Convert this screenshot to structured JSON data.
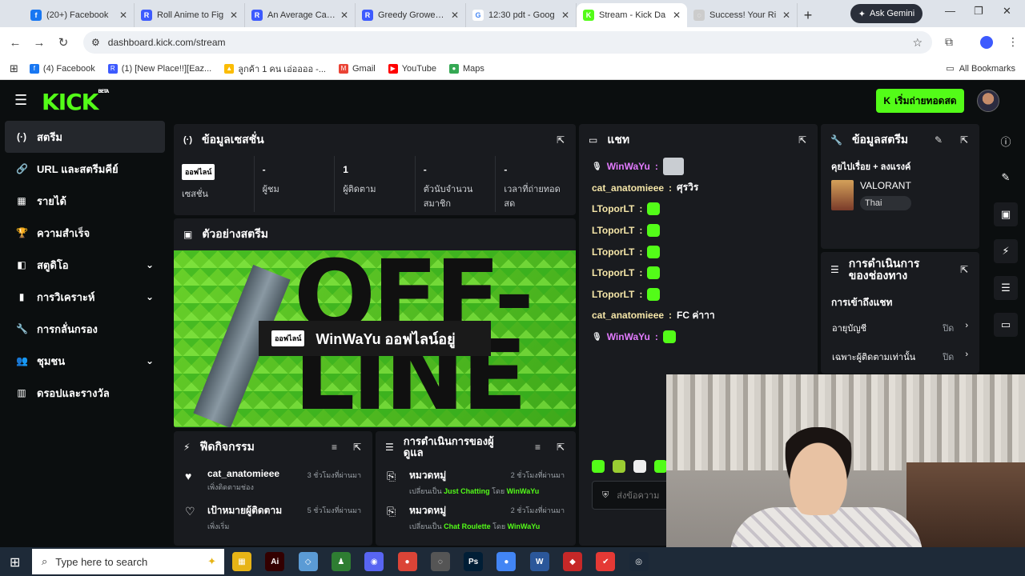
{
  "browser": {
    "tabs": [
      {
        "title": "(20+) Facebook",
        "color": "#1877f2",
        "glyph": "f"
      },
      {
        "title": "Roll Anime to Fig",
        "color": "#3d5afe",
        "glyph": "R"
      },
      {
        "title": "An Average Camp",
        "color": "#3d5afe",
        "glyph": "R"
      },
      {
        "title": "Greedy Growers |",
        "color": "#3d5afe",
        "glyph": "R"
      },
      {
        "title": "12:30 pdt - Goog",
        "color": "#ffffff",
        "glyph": "G"
      },
      {
        "title": "Stream - Kick Da",
        "color": "#53fc18",
        "glyph": "K"
      },
      {
        "title": "Success! Your Ri",
        "color": "#cccccc",
        "glyph": "◌"
      }
    ],
    "gemini_label": "Ask Gemini",
    "url": "dashboard.kick.com/stream",
    "bookmarks": [
      {
        "label": "(4) Facebook",
        "color": "#1877f2",
        "glyph": "f"
      },
      {
        "label": "(1) [New Place!!][Eaz...",
        "color": "#3d5afe",
        "glyph": "R"
      },
      {
        "label": "ลูกค้า 1 คน เอ่ออออ -...",
        "color": "#fbbc04",
        "glyph": "▲"
      },
      {
        "label": "Gmail",
        "color": "#ea4335",
        "glyph": "M"
      },
      {
        "label": "YouTube",
        "color": "#ff0000",
        "glyph": "▶"
      },
      {
        "label": "Maps",
        "color": "#34a853",
        "glyph": "●"
      }
    ],
    "all_bookmarks": "All Bookmarks"
  },
  "app": {
    "logo": "KICK",
    "logo_beta": "BETA",
    "go_live": "เริ่มถ่ายทอดสด",
    "sidebar": [
      {
        "label": "สตรีม",
        "icon": "(·)",
        "active": true,
        "chevron": false
      },
      {
        "label": "URL และสตรีมคีย์",
        "icon": "🔗",
        "active": false,
        "chevron": false
      },
      {
        "label": "รายได้",
        "icon": "▦",
        "active": false,
        "chevron": false
      },
      {
        "label": "ความสำเร็จ",
        "icon": "🏆",
        "active": false,
        "chevron": false
      },
      {
        "label": "สตูดิโอ",
        "icon": "◧",
        "active": false,
        "chevron": true
      },
      {
        "label": "การวิเคราะห์",
        "icon": "▮",
        "active": false,
        "chevron": true
      },
      {
        "label": "การกลั่นกรอง",
        "icon": "🔧",
        "active": false,
        "chevron": false
      },
      {
        "label": "ชุมชน",
        "icon": "👥",
        "active": false,
        "chevron": true
      },
      {
        "label": "ดรอปและรางวัล",
        "icon": "▥",
        "active": false,
        "chevron": false
      }
    ],
    "session": {
      "title": "ข้อมูลเซสชั่น",
      "stats": [
        {
          "value": "ออฟไลน์",
          "label": "เซสชั่น",
          "badge": true
        },
        {
          "value": "-",
          "label": "ผู้ชม",
          "badge": false
        },
        {
          "value": "1",
          "label": "ผู้ติดตาม",
          "badge": false
        },
        {
          "value": "-",
          "label": "ตัวนับจำนวนสมาชิก",
          "badge": false
        },
        {
          "value": "-",
          "label": "เวลาที่ถ่ายทอดสด",
          "badge": false
        }
      ]
    },
    "preview": {
      "title": "ตัวอย่างสตรีม",
      "badge": "ออฟไลน์",
      "status": "WinWaYu ออฟไลน์อยู่",
      "bg_text": "OFF-LINE"
    },
    "activity": {
      "title": "ฟีดกิจกรรม",
      "items": [
        {
          "name": "cat_anatomieee",
          "sub": "เพิ่งติดตามช่อง",
          "time": "3 ชั่วโมงที่ผ่านมา",
          "icon": "♥"
        },
        {
          "name": "เป้าหมายผู้ติดตาม",
          "sub": "เพิ่งเริ่ม",
          "time": "5 ชั่วโมงที่ผ่านมา",
          "icon": "♡"
        }
      ]
    },
    "modactions": {
      "title": "การดำเนินการของผู้ดูแล",
      "items": [
        {
          "name": "หมวดหมู่",
          "pre": "เปลี่ยนเป็น ",
          "cat": "Just Chatting",
          "mid": " โดย ",
          "by": "WinWaYu",
          "time": "2 ชั่วโมงที่ผ่านมา"
        },
        {
          "name": "หมวดหมู่",
          "pre": "เปลี่ยนเป็น ",
          "cat": "Chat Roulette",
          "mid": " โดย ",
          "by": "WinWaYu",
          "time": "2 ชั่วโมงที่ผ่านมา"
        }
      ]
    },
    "chat": {
      "title": "แชท",
      "messages": [
        {
          "user": "WinWaYu",
          "color": "#e37bff",
          "mic": true,
          "text": "",
          "emote": "cat"
        },
        {
          "user": "cat_anatomieee",
          "color": "#f5e6a8",
          "mic": false,
          "text": "ศุรวิร",
          "emote": ""
        },
        {
          "user": "LToporLT",
          "color": "#f5e6a8",
          "mic": false,
          "text": "",
          "emote": "green"
        },
        {
          "user": "LToporLT",
          "color": "#f5e6a8",
          "mic": false,
          "text": "",
          "emote": "green"
        },
        {
          "user": "LToporLT",
          "color": "#f5e6a8",
          "mic": false,
          "text": "",
          "emote": "green"
        },
        {
          "user": "LToporLT",
          "color": "#f5e6a8",
          "mic": false,
          "text": "",
          "emote": "green"
        },
        {
          "user": "LToporLT",
          "color": "#f5e6a8",
          "mic": false,
          "text": "",
          "emote": "green"
        },
        {
          "user": "cat_anatomieee",
          "color": "#f5e6a8",
          "mic": false,
          "text": "FC ค่าาา",
          "emote": ""
        },
        {
          "user": "WinWaYu",
          "color": "#e37bff",
          "mic": true,
          "text": "",
          "emote": "green"
        }
      ],
      "placeholder": "ส่งข้อความ"
    },
    "streaminfo": {
      "title": "ข้อมูลสตรีม",
      "stream_title": "คุยไปเรื่อย + ลงแรงค์",
      "category": "VALORANT",
      "tag": "Thai"
    },
    "channelactions": {
      "title": "การดำเนินการของช่องทาง",
      "section": "การเข้าถึงแชท",
      "rows": [
        {
          "label": "อายุบัญชี",
          "value": "ปิด"
        },
        {
          "label": "เฉพาะผู้ติดตามเท่านั้น",
          "value": "ปิด"
        }
      ]
    }
  },
  "taskbar": {
    "search_placeholder": "Type here to search",
    "apps": [
      {
        "glyph": "▦",
        "color": "#e7b416"
      },
      {
        "glyph": "Ai",
        "color": "#330000"
      },
      {
        "glyph": "◇",
        "color": "#5b9bd5"
      },
      {
        "glyph": "♟",
        "color": "#2e7d32"
      },
      {
        "glyph": "◉",
        "color": "#5865f2"
      },
      {
        "glyph": "●",
        "color": "#db4437"
      },
      {
        "glyph": "◌",
        "color": "#555555"
      },
      {
        "glyph": "Ps",
        "color": "#001e36"
      },
      {
        "glyph": "●",
        "color": "#4285f4"
      },
      {
        "glyph": "W",
        "color": "#2b579a"
      },
      {
        "glyph": "◆",
        "color": "#c62828"
      },
      {
        "glyph": "✔",
        "color": "#e53935"
      },
      {
        "glyph": "◎",
        "color": "#1b2838"
      }
    ]
  }
}
